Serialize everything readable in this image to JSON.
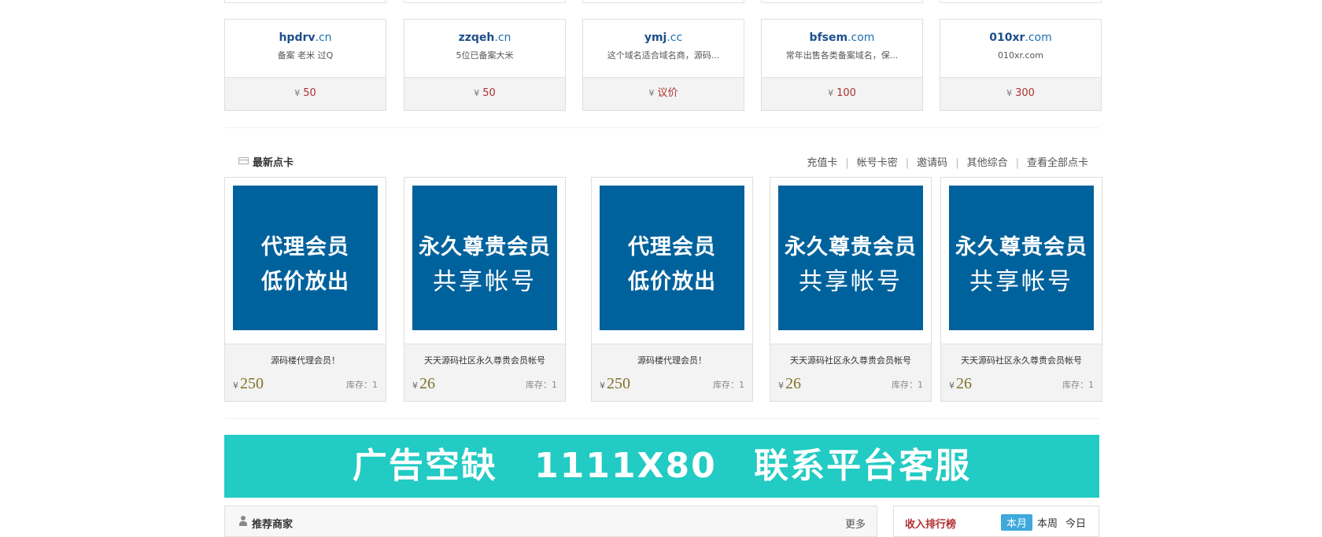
{
  "domains": [
    {
      "main": "hpdrv",
      "ext": ".cn",
      "desc": "备案 老米 过Q",
      "yen": "¥",
      "price": "50"
    },
    {
      "main": "zzqeh",
      "ext": ".cn",
      "desc": "5位已备案大米",
      "yen": "¥",
      "price": "50"
    },
    {
      "main": "ymj",
      "ext": ".cc",
      "desc": "这个域名适合域名商，源码...",
      "yen": "¥",
      "price": "议价"
    },
    {
      "main": "bfsem",
      "ext": ".com",
      "desc": "常年出售各类备案域名，保...",
      "yen": "¥",
      "price": "100"
    },
    {
      "main": "010xr",
      "ext": ".com",
      "desc": "010xr.com",
      "yen": "¥",
      "price": "300"
    }
  ],
  "cards_section": {
    "title": "最新点卡",
    "links": [
      "充值卡",
      "帐号卡密",
      "邀请码",
      "其他综合",
      "查看全部点卡"
    ],
    "separator": "|"
  },
  "products": [
    {
      "line1": "代理会员",
      "line2": "低价放出",
      "name": "源码楼代理会员！",
      "yen": "¥",
      "price": "250",
      "stock": "库存：1"
    },
    {
      "line1": "永久尊贵会员",
      "line2": "共享帐号",
      "name": "天天源码社区永久尊贵会员帐号",
      "yen": "¥",
      "price": "26",
      "stock": "库存：1"
    },
    {
      "line1": "代理会员",
      "line2": "低价放出",
      "name": "源码楼代理会员！",
      "yen": "¥",
      "price": "250",
      "stock": "库存：1"
    },
    {
      "line1": "永久尊贵会员",
      "line2": "共享帐号",
      "name": "天天源码社区永久尊贵会员帐号",
      "yen": "¥",
      "price": "26",
      "stock": "库存：1"
    },
    {
      "line1": "永久尊贵会员",
      "line2": "共享帐号",
      "name": "天天源码社区永久尊贵会员帐号",
      "yen": "¥",
      "price": "26",
      "stock": "库存：1"
    }
  ],
  "banner": {
    "text": "广告空缺 1111X80 联系平台客服"
  },
  "merchants": {
    "title": "推荐商家",
    "more": "更多"
  },
  "ranking": {
    "title": "收入排行榜",
    "tabs": [
      "本月",
      "本周",
      "今日"
    ]
  },
  "colors": {
    "accent_blue": "#00629c",
    "banner_teal": "#22cbc3",
    "price_red": "#b03030",
    "price_olive": "#807228",
    "tab_active": "#3fa9dc"
  }
}
